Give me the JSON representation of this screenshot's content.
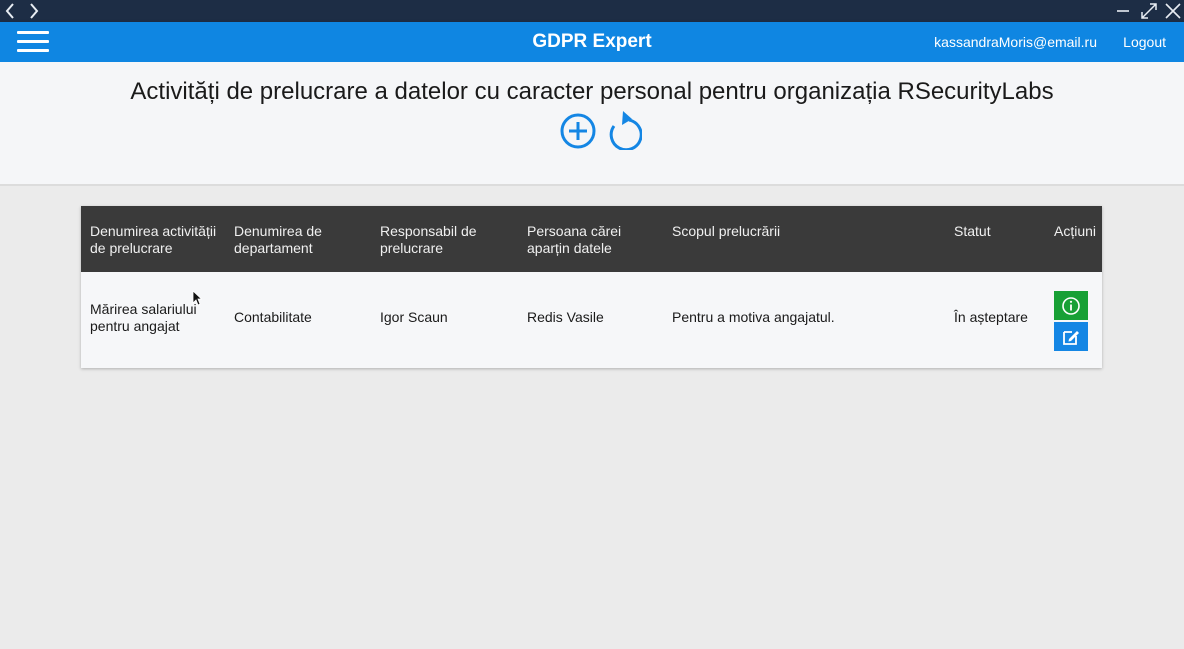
{
  "window_chrome": {
    "icons": [
      "chevron-left-icon",
      "chevron-right-icon",
      "minimize-icon",
      "maximize-icon",
      "close-icon"
    ]
  },
  "header": {
    "title": "GDPR Expert",
    "user_email": "kassandraMoris@email.ru",
    "logout_label": "Logout",
    "menu_icon": "hamburger-menu-icon"
  },
  "page": {
    "title": "Activități de prelucrare a datelor cu caracter personal pentru organizația RSecurityLabs",
    "add_icon": "plus-circle-icon",
    "refresh_icon": "refresh-icon"
  },
  "table": {
    "columns": [
      "Denumirea activității de prelucrare",
      "Denumirea de departament",
      "Responsabil de prelucrare",
      "Persoana cărei aparțin datele",
      "Scopul prelucrării",
      "Statut",
      "Acțiuni"
    ],
    "rows": [
      {
        "activity": "Mărirea salariului pentru angajat",
        "department": "Contabilitate",
        "responsible": "Igor Scaun",
        "person": "Redis Vasile",
        "purpose": "Pentru a motiva angajatul.",
        "status": "În așteptare",
        "actions": [
          "info-icon",
          "edit-icon"
        ]
      }
    ]
  },
  "colors": {
    "chrome": "#1d2d45",
    "appbar": "#0f86e2",
    "table_header": "#3a3a3a",
    "info_button": "#17a035",
    "edit_button": "#1486e4"
  }
}
